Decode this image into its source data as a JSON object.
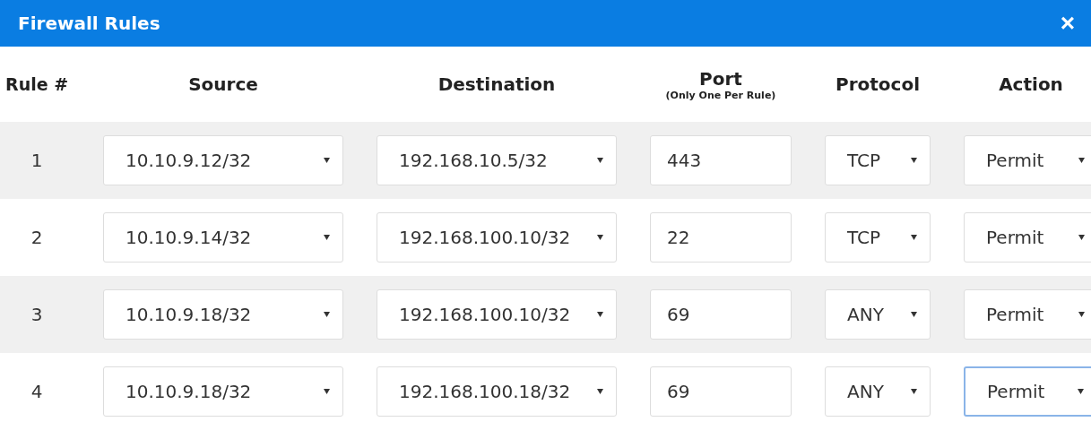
{
  "window": {
    "title": "Firewall Rules",
    "close": "×"
  },
  "columns": {
    "rule": "Rule #",
    "source": "Source",
    "destination": "Destination",
    "port": "Port",
    "port_note": "(Only One Per Rule)",
    "protocol": "Protocol",
    "action": "Action"
  },
  "rows": [
    {
      "rule": "1",
      "source": "10.10.9.12/32",
      "destination": "192.168.10.5/32",
      "port": "443",
      "protocol": "TCP",
      "action": "Permit",
      "action_focused": false
    },
    {
      "rule": "2",
      "source": "10.10.9.14/32",
      "destination": "192.168.100.10/32",
      "port": "22",
      "protocol": "TCP",
      "action": "Permit",
      "action_focused": false
    },
    {
      "rule": "3",
      "source": "10.10.9.18/32",
      "destination": "192.168.100.10/32",
      "port": "69",
      "protocol": "ANY",
      "action": "Permit",
      "action_focused": false
    },
    {
      "rule": "4",
      "source": "10.10.9.18/32",
      "destination": "192.168.100.18/32",
      "port": "69",
      "protocol": "ANY",
      "action": "Permit",
      "action_focused": true
    }
  ]
}
